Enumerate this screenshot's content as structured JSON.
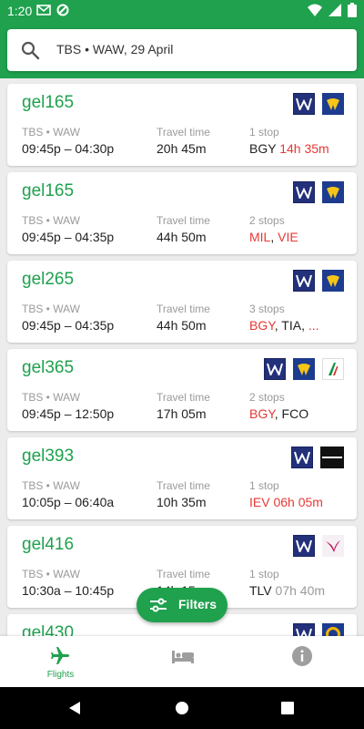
{
  "status_bar": {
    "time": "1:20"
  },
  "search": {
    "query": "TBS • WAW, 29 April"
  },
  "labels": {
    "travel_time": "Travel time"
  },
  "colors": {
    "brand": "#1fa14e",
    "stop_highlight": "#e53935"
  },
  "flights": [
    {
      "price": "gel165",
      "route": "TBS • WAW",
      "times": "09:45p – 04:30p",
      "duration": "20h 45m",
      "stops_label": "1 stop",
      "stops": [
        {
          "text": "BGY ",
          "style": "normal"
        },
        {
          "text": "14h 35m",
          "style": "red"
        }
      ],
      "airlines": [
        "wizz",
        "ryanair"
      ]
    },
    {
      "price": "gel165",
      "route": "TBS • WAW",
      "times": "09:45p – 04:35p",
      "duration": "44h 50m",
      "stops_label": "2 stops",
      "stops": [
        {
          "text": "MIL",
          "style": "red"
        },
        {
          "text": ", ",
          "style": "normal"
        },
        {
          "text": "VIE",
          "style": "red"
        }
      ],
      "airlines": [
        "wizz",
        "ryanair"
      ]
    },
    {
      "price": "gel265",
      "route": "TBS • WAW",
      "times": "09:45p – 04:35p",
      "duration": "44h 50m",
      "stops_label": "3 stops",
      "stops": [
        {
          "text": "BGY",
          "style": "red"
        },
        {
          "text": ", TIA, ",
          "style": "normal"
        },
        {
          "text": "...",
          "style": "red"
        }
      ],
      "airlines": [
        "wizz",
        "ryanair"
      ]
    },
    {
      "price": "gel365",
      "route": "TBS • WAW",
      "times": "09:45p – 12:50p",
      "duration": "17h 05m",
      "stops_label": "2 stops",
      "stops": [
        {
          "text": "BGY",
          "style": "red"
        },
        {
          "text": ", FCO",
          "style": "normal"
        }
      ],
      "airlines": [
        "wizz",
        "ryanair",
        "alitalia"
      ]
    },
    {
      "price": "gel393",
      "route": "TBS • WAW",
      "times": "10:05p – 06:40a",
      "duration": "10h 35m",
      "stops_label": "1 stop",
      "stops": [
        {
          "text": "IEV 06h 05m",
          "style": "red"
        }
      ],
      "airlines": [
        "wizz",
        "skyup"
      ]
    },
    {
      "price": "gel416",
      "route": "TBS • WAW",
      "times": "10:30a – 10:45p",
      "duration": "14h 15m",
      "stops_label": "1 stop",
      "stops": [
        {
          "text": "TLV ",
          "style": "normal"
        },
        {
          "text": "07h 40m",
          "style": "grey"
        }
      ],
      "airlines": [
        "wizz",
        "pobeda"
      ]
    },
    {
      "price": "gel430",
      "route": "",
      "times": "",
      "duration": "",
      "stops_label": "",
      "stops": [],
      "airlines": [
        "wizz",
        "lufthansa"
      ]
    }
  ],
  "filters_button": {
    "label": "Filters"
  },
  "bottom_nav": [
    {
      "id": "flights",
      "label": "Flights",
      "icon": "airplane-icon",
      "active": true
    },
    {
      "id": "hotels",
      "label": "",
      "icon": "bed-icon",
      "active": false
    },
    {
      "id": "info",
      "label": "",
      "icon": "info-icon",
      "active": false
    }
  ]
}
